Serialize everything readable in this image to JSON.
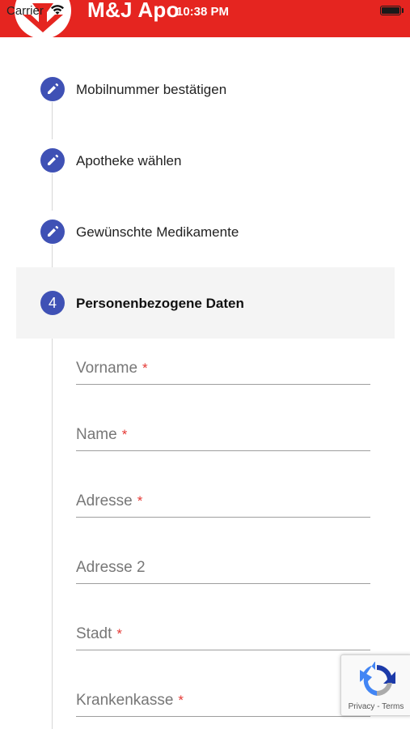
{
  "status_bar": {
    "carrier": "Carrier",
    "time": "10:38 PM"
  },
  "header": {
    "app_title": "M&J Apo",
    "brand_color": "#e52520",
    "logo_icon": "pharmacy-logo-icon"
  },
  "stepper": {
    "accent_color": "#3f51b5",
    "steps": [
      {
        "label": "Mobilnummer bestätigen",
        "state": "completed",
        "icon": "edit-pencil-icon"
      },
      {
        "label": "Apotheke wählen",
        "state": "completed",
        "icon": "edit-pencil-icon"
      },
      {
        "label": "Gewünschte Medikamente",
        "state": "completed",
        "icon": "edit-pencil-icon"
      },
      {
        "label": "Personenbezogene Daten",
        "state": "active",
        "number": "4"
      }
    ]
  },
  "form": {
    "fields": [
      {
        "label": "Vorname",
        "required": true,
        "value": ""
      },
      {
        "label": "Name",
        "required": true,
        "value": ""
      },
      {
        "label": "Adresse",
        "required": true,
        "value": ""
      },
      {
        "label": "Adresse 2",
        "required": false,
        "value": ""
      },
      {
        "label": "Stadt",
        "required": true,
        "value": ""
      },
      {
        "label": "Krankenkasse",
        "required": true,
        "value": ""
      }
    ],
    "required_marker": "*"
  },
  "recaptcha": {
    "icon": "recaptcha-icon",
    "privacy": "Privacy",
    "separator": " - ",
    "terms": "Terms"
  }
}
